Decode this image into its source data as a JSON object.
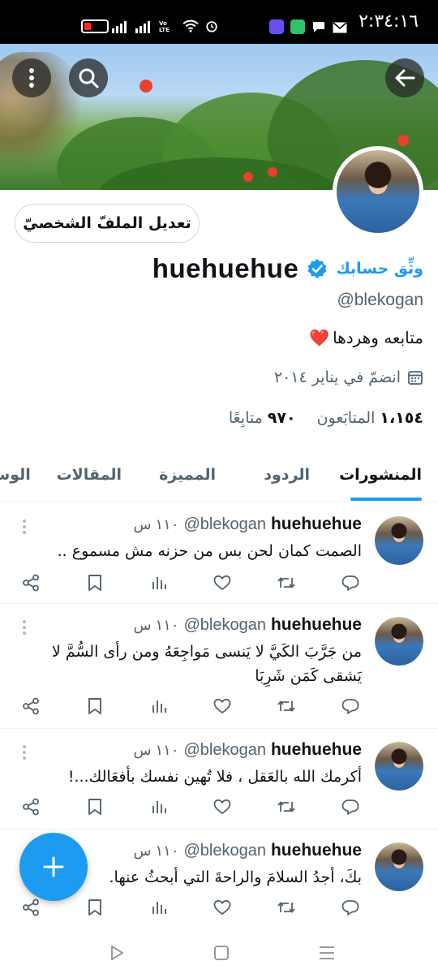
{
  "status_bar": {
    "time": "٢:٣٤:١٦",
    "volte": "Vo LTE"
  },
  "colors": {
    "accent": "#1d9bf0",
    "text_primary": "#0f1419",
    "text_secondary": "#536471",
    "battery_low": "#ff2a2a"
  },
  "header": {
    "icons": [
      "back-arrow-icon",
      "search-icon",
      "more-vertical-icon"
    ]
  },
  "profile": {
    "edit_button": "تعديل الملفّ الشخصيّ",
    "display_name": "huehuehue",
    "verify_link": "وثِّق حسابك",
    "handle": "@blekogan",
    "bio": "متابعه وهردها",
    "bio_emoji": "❤️",
    "joined": "انضمّ في يناير ٢٠١٤",
    "followers_count": "١،١٥٤",
    "followers_label": "المتابَعون",
    "following_count": "٩٧٠",
    "following_label": "متابِعًا"
  },
  "tabs": [
    {
      "label": "المنشورات",
      "active": true
    },
    {
      "label": "الردود",
      "active": false
    },
    {
      "label": "المميزة",
      "active": false
    },
    {
      "label": "المقالات",
      "active": false
    },
    {
      "label": "الوس",
      "active": false
    }
  ],
  "tweets": [
    {
      "name": "huehuehue",
      "handle": "@blekogan",
      "time": "١١٠ س",
      "text": "الصمت كمان لحن بس من حزنه مش مسموع .."
    },
    {
      "name": "huehuehue",
      "handle": "@blekogan",
      "time": "١١٠ س",
      "text": "من جَرَّبَ الكَيَّ لا يَنسى مَواجِعَهُ ومن رأى السُّمَّ لا يَشقى كَمَن شَرِبَا"
    },
    {
      "name": "huehuehue",
      "handle": "@blekogan",
      "time": "١١٠ س",
      "text": "أكرمك الله بالعَقل ، فلا تُهين نفسك بأفعَالك...!"
    },
    {
      "name": "huehuehue",
      "handle": "@blekogan",
      "time": "١١٠ س",
      "text": "بكَ، أجدُ السلامَ والراحةَ التي أبحثُ عنها."
    }
  ],
  "tweet_actions": [
    "reply-icon",
    "retweet-icon",
    "like-icon",
    "views-icon",
    "bookmark-icon",
    "share-icon"
  ],
  "fab": {
    "icon": "plus-icon"
  },
  "system_nav": [
    "back-triangle-icon",
    "home-square-icon",
    "recents-menu-icon"
  ]
}
